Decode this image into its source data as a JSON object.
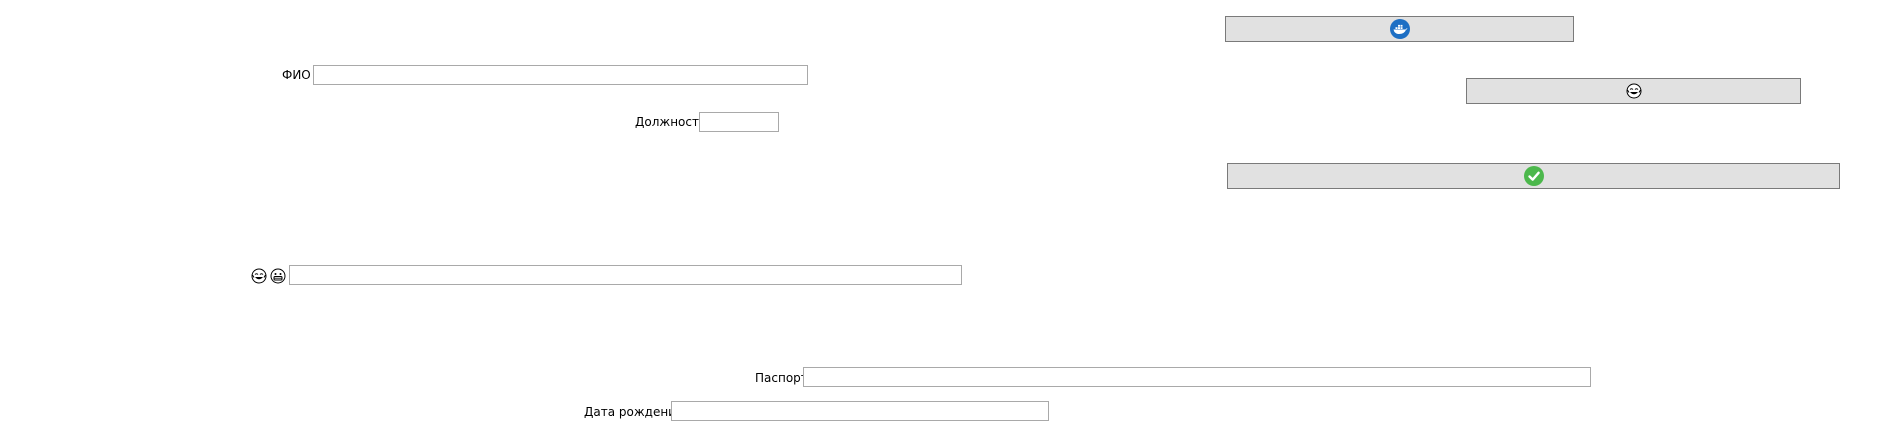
{
  "form": {
    "fio": {
      "label": "ФИО",
      "value": "",
      "placeholder": ""
    },
    "position": {
      "label": "Должность",
      "value": "",
      "placeholder": ""
    },
    "emoji_row": {
      "value": "",
      "placeholder": ""
    },
    "passport": {
      "label": "Паспорт",
      "value": "",
      "placeholder": ""
    },
    "birth_date": {
      "label": "Дата рождения",
      "value": "",
      "placeholder": ""
    }
  },
  "buttons": {
    "top": {
      "icon": "whale-docker-icon"
    },
    "middle": {
      "icon": "grinning-tears-emoji-icon"
    },
    "bottom": {
      "icon": "check-mark-icon"
    }
  },
  "icons": {
    "emoji_left": "grinning-tears-emoji-icon",
    "emoji_right": "grinning-face-emoji-icon"
  },
  "colors": {
    "button_bg": "#e1e1e1",
    "button_border": "#7a7a7a",
    "field_border": "#a9a9a9",
    "docker_blue": "#1d6fc4",
    "check_green": "#4cb84c"
  }
}
